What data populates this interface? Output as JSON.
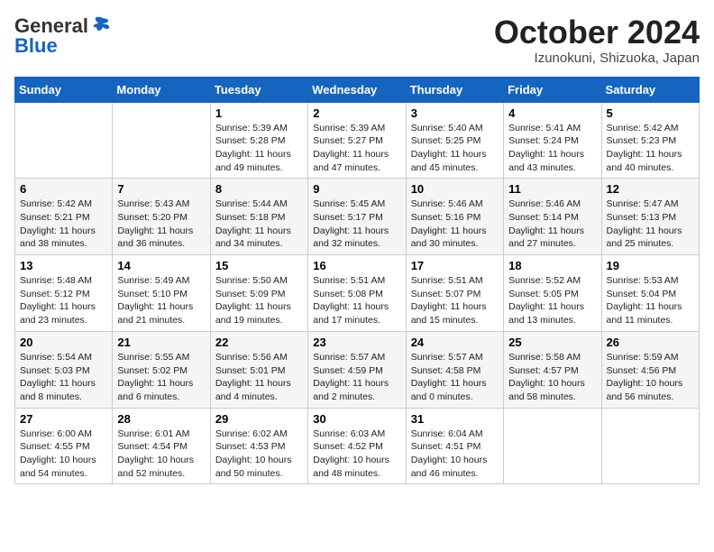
{
  "header": {
    "logo_general": "General",
    "logo_blue": "Blue",
    "month_title": "October 2024",
    "location": "Izunokuni, Shizuoka, Japan"
  },
  "weekdays": [
    "Sunday",
    "Monday",
    "Tuesday",
    "Wednesday",
    "Thursday",
    "Friday",
    "Saturday"
  ],
  "weeks": [
    [
      {
        "day": "",
        "sunrise": "",
        "sunset": "",
        "daylight": ""
      },
      {
        "day": "",
        "sunrise": "",
        "sunset": "",
        "daylight": ""
      },
      {
        "day": "1",
        "sunrise": "Sunrise: 5:39 AM",
        "sunset": "Sunset: 5:28 PM",
        "daylight": "Daylight: 11 hours and 49 minutes."
      },
      {
        "day": "2",
        "sunrise": "Sunrise: 5:39 AM",
        "sunset": "Sunset: 5:27 PM",
        "daylight": "Daylight: 11 hours and 47 minutes."
      },
      {
        "day": "3",
        "sunrise": "Sunrise: 5:40 AM",
        "sunset": "Sunset: 5:25 PM",
        "daylight": "Daylight: 11 hours and 45 minutes."
      },
      {
        "day": "4",
        "sunrise": "Sunrise: 5:41 AM",
        "sunset": "Sunset: 5:24 PM",
        "daylight": "Daylight: 11 hours and 43 minutes."
      },
      {
        "day": "5",
        "sunrise": "Sunrise: 5:42 AM",
        "sunset": "Sunset: 5:23 PM",
        "daylight": "Daylight: 11 hours and 40 minutes."
      }
    ],
    [
      {
        "day": "6",
        "sunrise": "Sunrise: 5:42 AM",
        "sunset": "Sunset: 5:21 PM",
        "daylight": "Daylight: 11 hours and 38 minutes."
      },
      {
        "day": "7",
        "sunrise": "Sunrise: 5:43 AM",
        "sunset": "Sunset: 5:20 PM",
        "daylight": "Daylight: 11 hours and 36 minutes."
      },
      {
        "day": "8",
        "sunrise": "Sunrise: 5:44 AM",
        "sunset": "Sunset: 5:18 PM",
        "daylight": "Daylight: 11 hours and 34 minutes."
      },
      {
        "day": "9",
        "sunrise": "Sunrise: 5:45 AM",
        "sunset": "Sunset: 5:17 PM",
        "daylight": "Daylight: 11 hours and 32 minutes."
      },
      {
        "day": "10",
        "sunrise": "Sunrise: 5:46 AM",
        "sunset": "Sunset: 5:16 PM",
        "daylight": "Daylight: 11 hours and 30 minutes."
      },
      {
        "day": "11",
        "sunrise": "Sunrise: 5:46 AM",
        "sunset": "Sunset: 5:14 PM",
        "daylight": "Daylight: 11 hours and 27 minutes."
      },
      {
        "day": "12",
        "sunrise": "Sunrise: 5:47 AM",
        "sunset": "Sunset: 5:13 PM",
        "daylight": "Daylight: 11 hours and 25 minutes."
      }
    ],
    [
      {
        "day": "13",
        "sunrise": "Sunrise: 5:48 AM",
        "sunset": "Sunset: 5:12 PM",
        "daylight": "Daylight: 11 hours and 23 minutes."
      },
      {
        "day": "14",
        "sunrise": "Sunrise: 5:49 AM",
        "sunset": "Sunset: 5:10 PM",
        "daylight": "Daylight: 11 hours and 21 minutes."
      },
      {
        "day": "15",
        "sunrise": "Sunrise: 5:50 AM",
        "sunset": "Sunset: 5:09 PM",
        "daylight": "Daylight: 11 hours and 19 minutes."
      },
      {
        "day": "16",
        "sunrise": "Sunrise: 5:51 AM",
        "sunset": "Sunset: 5:08 PM",
        "daylight": "Daylight: 11 hours and 17 minutes."
      },
      {
        "day": "17",
        "sunrise": "Sunrise: 5:51 AM",
        "sunset": "Sunset: 5:07 PM",
        "daylight": "Daylight: 11 hours and 15 minutes."
      },
      {
        "day": "18",
        "sunrise": "Sunrise: 5:52 AM",
        "sunset": "Sunset: 5:05 PM",
        "daylight": "Daylight: 11 hours and 13 minutes."
      },
      {
        "day": "19",
        "sunrise": "Sunrise: 5:53 AM",
        "sunset": "Sunset: 5:04 PM",
        "daylight": "Daylight: 11 hours and 11 minutes."
      }
    ],
    [
      {
        "day": "20",
        "sunrise": "Sunrise: 5:54 AM",
        "sunset": "Sunset: 5:03 PM",
        "daylight": "Daylight: 11 hours and 8 minutes."
      },
      {
        "day": "21",
        "sunrise": "Sunrise: 5:55 AM",
        "sunset": "Sunset: 5:02 PM",
        "daylight": "Daylight: 11 hours and 6 minutes."
      },
      {
        "day": "22",
        "sunrise": "Sunrise: 5:56 AM",
        "sunset": "Sunset: 5:01 PM",
        "daylight": "Daylight: 11 hours and 4 minutes."
      },
      {
        "day": "23",
        "sunrise": "Sunrise: 5:57 AM",
        "sunset": "Sunset: 4:59 PM",
        "daylight": "Daylight: 11 hours and 2 minutes."
      },
      {
        "day": "24",
        "sunrise": "Sunrise: 5:57 AM",
        "sunset": "Sunset: 4:58 PM",
        "daylight": "Daylight: 11 hours and 0 minutes."
      },
      {
        "day": "25",
        "sunrise": "Sunrise: 5:58 AM",
        "sunset": "Sunset: 4:57 PM",
        "daylight": "Daylight: 10 hours and 58 minutes."
      },
      {
        "day": "26",
        "sunrise": "Sunrise: 5:59 AM",
        "sunset": "Sunset: 4:56 PM",
        "daylight": "Daylight: 10 hours and 56 minutes."
      }
    ],
    [
      {
        "day": "27",
        "sunrise": "Sunrise: 6:00 AM",
        "sunset": "Sunset: 4:55 PM",
        "daylight": "Daylight: 10 hours and 54 minutes."
      },
      {
        "day": "28",
        "sunrise": "Sunrise: 6:01 AM",
        "sunset": "Sunset: 4:54 PM",
        "daylight": "Daylight: 10 hours and 52 minutes."
      },
      {
        "day": "29",
        "sunrise": "Sunrise: 6:02 AM",
        "sunset": "Sunset: 4:53 PM",
        "daylight": "Daylight: 10 hours and 50 minutes."
      },
      {
        "day": "30",
        "sunrise": "Sunrise: 6:03 AM",
        "sunset": "Sunset: 4:52 PM",
        "daylight": "Daylight: 10 hours and 48 minutes."
      },
      {
        "day": "31",
        "sunrise": "Sunrise: 6:04 AM",
        "sunset": "Sunset: 4:51 PM",
        "daylight": "Daylight: 10 hours and 46 minutes."
      },
      {
        "day": "",
        "sunrise": "",
        "sunset": "",
        "daylight": ""
      },
      {
        "day": "",
        "sunrise": "",
        "sunset": "",
        "daylight": ""
      }
    ]
  ]
}
